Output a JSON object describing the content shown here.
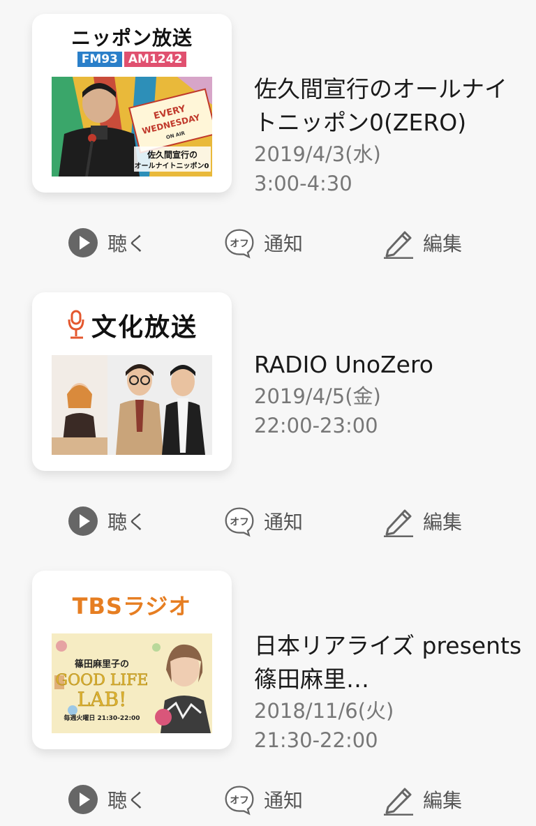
{
  "actions": {
    "listen_label": "聴く",
    "notify_label": "通知",
    "notify_badge": "オフ",
    "edit_label": "編集"
  },
  "programs": [
    {
      "station": "ニッポン放送",
      "station_sub_fm": "FM93",
      "station_sub_am": "AM1242",
      "thumb_text": [
        "EVERY",
        "WEDNESDAY",
        "ON AIR",
        "佐久間宣行の",
        "オールナイトニッポン0"
      ],
      "title": "佐久間宣行のオールナイトニッポン0(ZERO)",
      "date": "2019/4/3(水)",
      "time": "3:00-4:30"
    },
    {
      "station": "文化放送",
      "title": "RADIO UnoZero",
      "date": "2019/4/5(金)",
      "time": "22:00-23:00"
    },
    {
      "station": "TBSラジオ",
      "thumb_text": [
        "篠田麻里子の",
        "GOOD LIFE",
        "LAB!",
        "毎週火曜日 21:30-22:00"
      ],
      "title": "日本リアライズ presents 篠田麻里…",
      "date": "2018/11/6(火)",
      "time": "21:30-22:00"
    }
  ],
  "colors": {
    "background": "#f7f7f7",
    "icon_gray": "#666666",
    "fm_blue": "#2a7fc9",
    "am_pink": "#e0506f",
    "tbs_orange": "#e67e22",
    "bunka_orange": "#e4572e"
  }
}
